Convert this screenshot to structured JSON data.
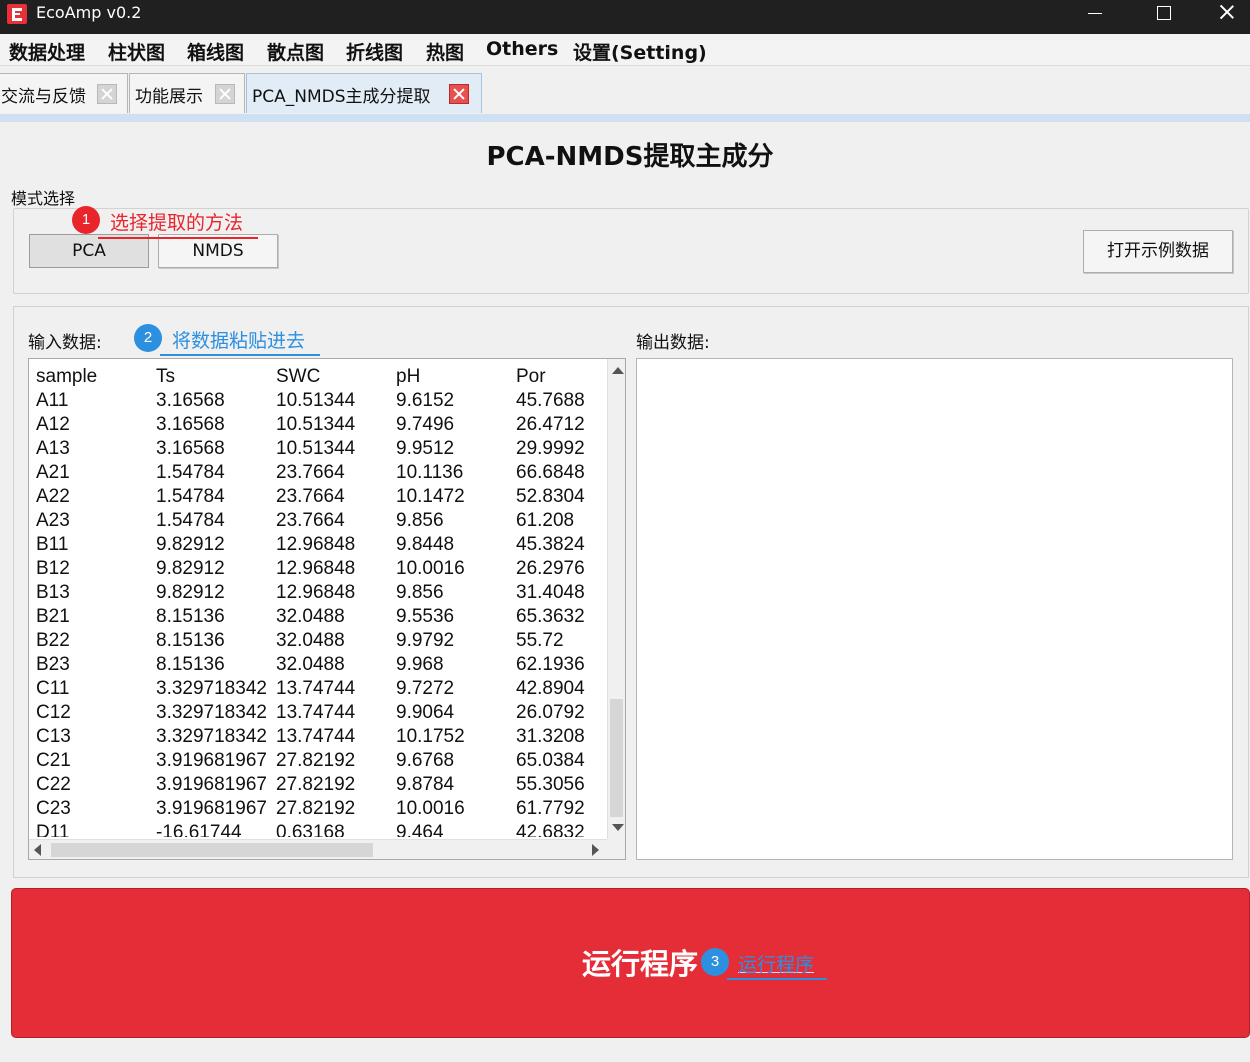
{
  "window": {
    "title": "EcoAmp v0.2",
    "icon": "app-e-logo",
    "controls": [
      "minimize-icon",
      "maximize-icon",
      "close-icon"
    ]
  },
  "menu": [
    "数据处理",
    "柱状图",
    "箱线图",
    "散点图",
    "折线图",
    "热图",
    "Others",
    "设置(Setting)"
  ],
  "tabs": [
    {
      "label": "交流与反馈",
      "active": false
    },
    {
      "label": "功能展示",
      "active": false
    },
    {
      "label": "PCA_NMDS主成分提取",
      "active": true
    }
  ],
  "page": {
    "title": "PCA-NMDS提取主成分",
    "mode_label": "模式选择",
    "mode_buttons": [
      "PCA",
      "NMDS"
    ],
    "open_example_label": "打开示例数据",
    "input_label": "输入数据:",
    "output_label": "输出数据:",
    "run_label": "运行程序"
  },
  "annotations": [
    {
      "num": "1",
      "text": "选择提取的方法",
      "color": "#e8252b"
    },
    {
      "num": "2",
      "text": "将数据粘贴进去",
      "color": "#2d8fe0"
    },
    {
      "num": "3",
      "text": "运行程序",
      "color": "#2d8fe0"
    }
  ],
  "input_table": {
    "header": [
      "sample",
      "Ts",
      "SWC",
      "pH",
      "Por"
    ],
    "rows": [
      [
        "A11",
        "3.16568",
        "10.51344",
        "9.6152",
        "45.7688"
      ],
      [
        "A12",
        "3.16568",
        "10.51344",
        "9.7496",
        "26.4712"
      ],
      [
        "A13",
        "3.16568",
        "10.51344",
        "9.9512",
        "29.9992"
      ],
      [
        "A21",
        "1.54784",
        "23.7664",
        "10.1136",
        "66.6848"
      ],
      [
        "A22",
        "1.54784",
        "23.7664",
        "10.1472",
        "52.8304"
      ],
      [
        "A23",
        "1.54784",
        "23.7664",
        "9.856",
        "61.208"
      ],
      [
        "B11",
        "9.82912",
        "12.96848",
        "9.8448",
        "45.3824"
      ],
      [
        "B12",
        "9.82912",
        "12.96848",
        "10.0016",
        "26.2976"
      ],
      [
        "B13",
        "9.82912",
        "12.96848",
        "9.856",
        "31.4048"
      ],
      [
        "B21",
        "8.15136",
        "32.0488",
        "9.5536",
        "65.3632"
      ],
      [
        "B22",
        "8.15136",
        "32.0488",
        "9.9792",
        "55.72"
      ],
      [
        "B23",
        "8.15136",
        "32.0488",
        "9.968",
        "62.1936"
      ],
      [
        "C11",
        "3.329718342",
        "13.74744",
        "9.7272",
        "42.8904"
      ],
      [
        "C12",
        "3.329718342",
        "13.74744",
        "9.9064",
        "26.0792"
      ],
      [
        "C13",
        "3.329718342",
        "13.74744",
        "10.1752",
        "31.3208"
      ],
      [
        "C21",
        "3.919681967",
        "27.82192",
        "9.6768",
        "65.0384"
      ],
      [
        "C22",
        "3.919681967",
        "27.82192",
        "9.8784",
        "55.3056"
      ],
      [
        "C23",
        "3.919681967",
        "27.82192",
        "10.0016",
        "61.7792"
      ],
      [
        "D11",
        "-16.61744",
        "0.63168",
        "9.464",
        "42.6832"
      ]
    ]
  },
  "colors": {
    "run_button": "#e52d38",
    "annotation_red": "#e8252b",
    "annotation_blue": "#2d8fe0",
    "active_tab": "#e1ecf7"
  }
}
